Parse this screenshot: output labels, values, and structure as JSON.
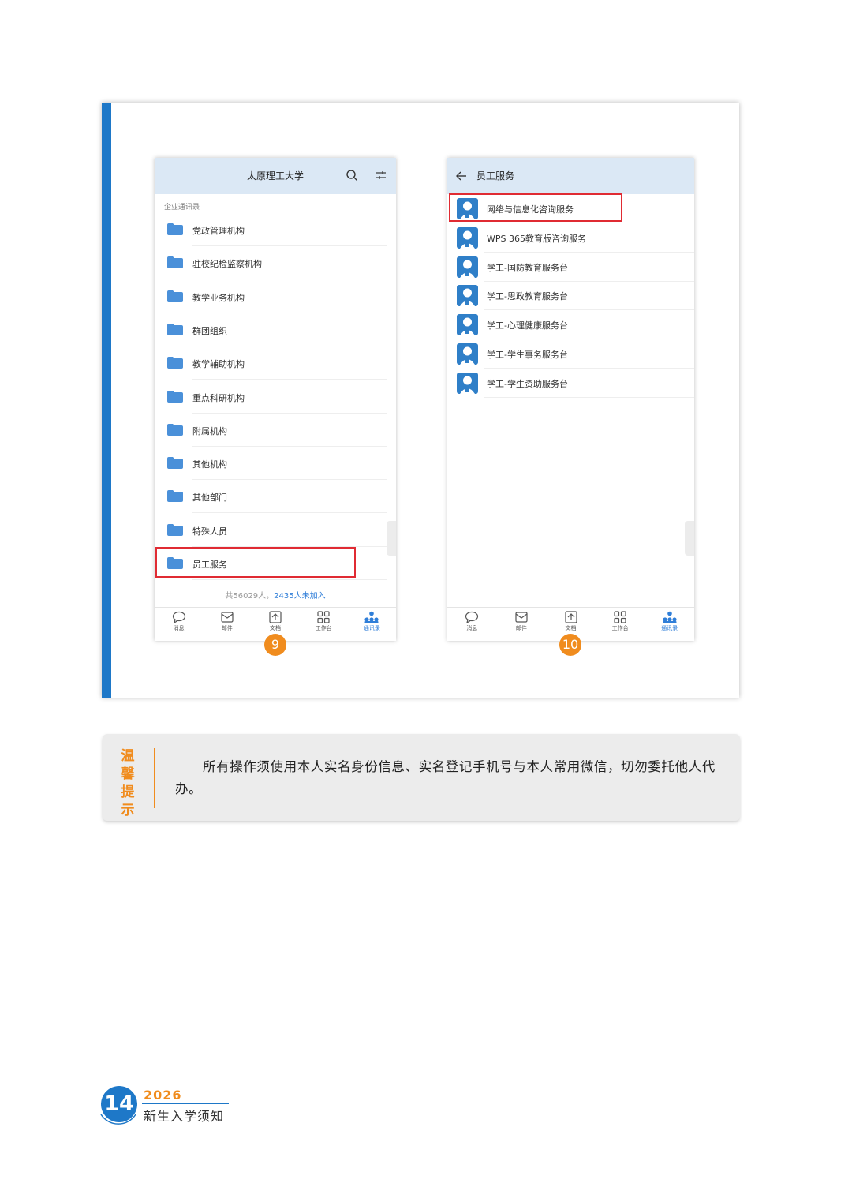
{
  "left_phone": {
    "header_title": "太原理工大学",
    "section_label": "企业通讯录",
    "folders": [
      "党政管理机构",
      "驻校纪检监察机构",
      "教学业务机构",
      "群团组织",
      "教学辅助机构",
      "重点科研机构",
      "附属机构",
      "其他机构",
      "其他部门",
      "特殊人员",
      "员工服务"
    ],
    "count_prefix": "共56029人，",
    "count_highlight": "2435人未加入",
    "step": "9"
  },
  "right_phone": {
    "header_title": "员工服务",
    "contacts": [
      "网络与信息化咨询服务",
      "WPS 365教育版咨询服务",
      "学工-国防教育服务台",
      "学工-思政教育服务台",
      "学工-心理健康服务台",
      "学工-学生事务服务台",
      "学工-学生资助服务台"
    ],
    "step": "10"
  },
  "tabbar": {
    "tabs": [
      "消息",
      "邮件",
      "文档",
      "工作台",
      "通讯录"
    ],
    "active": "通讯录"
  },
  "tip": {
    "label": "温馨提示",
    "text": "所有操作须使用本人实名身份信息、实名登记手机号与本人常用微信，切勿委托他人代办。"
  },
  "footer": {
    "page_number": "14",
    "year": "2026",
    "title": "新生入学须知"
  },
  "colors": {
    "accent_blue": "#1e78c8",
    "accent_orange": "#f08c1e",
    "highlight_red": "#e02b33",
    "header_bg": "#dbe8f5"
  }
}
